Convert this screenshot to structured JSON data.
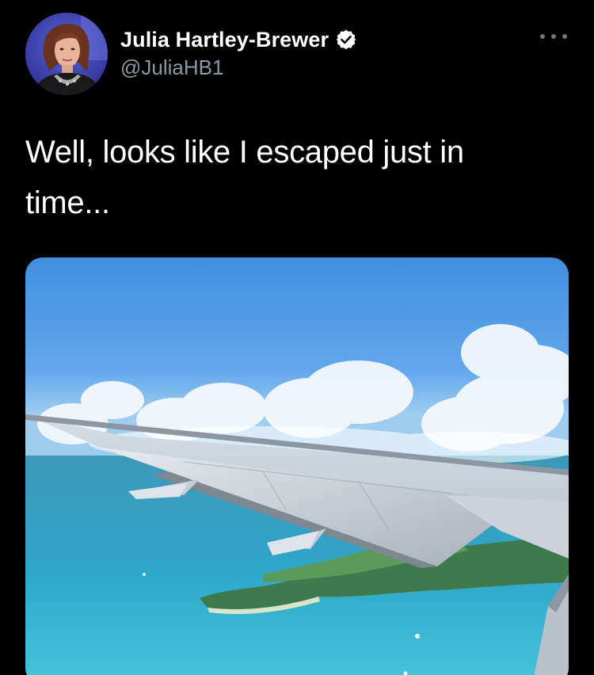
{
  "author": {
    "display_name": "Julia Hartley-Brewer",
    "handle": "@JuliaHB1",
    "verified": true,
    "avatar_icon": "profile-photo"
  },
  "tweet": {
    "text": "Well, looks like I escaped just in time..."
  },
  "media": {
    "icon": "airplane-wing-over-sea-photo"
  },
  "colors": {
    "background": "#000000",
    "display_name": "#ffffff",
    "handle": "#8b98a5",
    "verified_badge": "#ffffff",
    "more_dots": "#6e767d"
  }
}
